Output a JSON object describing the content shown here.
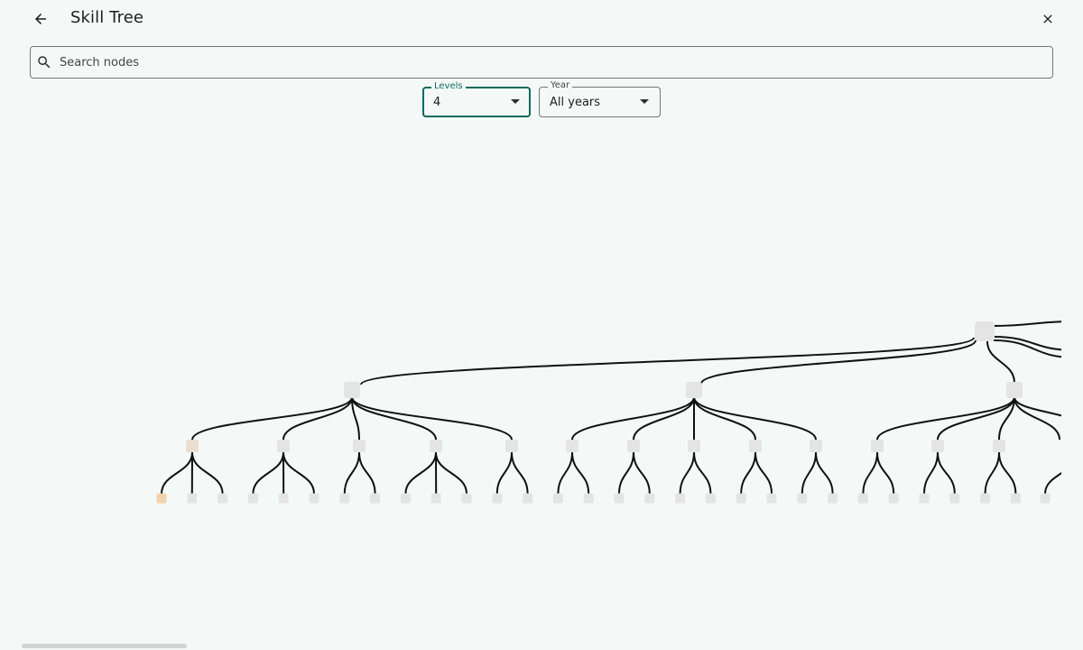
{
  "header": {
    "title": "Skill Tree",
    "back_icon": "arrow-left-icon",
    "close_icon": "close-icon"
  },
  "search": {
    "placeholder": "Search nodes",
    "value": "",
    "icon": "search-icon"
  },
  "filters": {
    "levels": {
      "label": "Levels",
      "value": "4",
      "icon": "caret-down-icon"
    },
    "year": {
      "label": "Year",
      "value": "All years",
      "icon": "caret-down-icon"
    }
  },
  "tree": {
    "levels_shown": 4,
    "highlighted_leaf": "first leaf",
    "colors": {
      "node": "#e4e4e4",
      "edge": "#111111",
      "highlight_leaf": "#f2d2ad",
      "highlight_mid": "#eaded1",
      "accent": "#0a6b5b"
    }
  }
}
